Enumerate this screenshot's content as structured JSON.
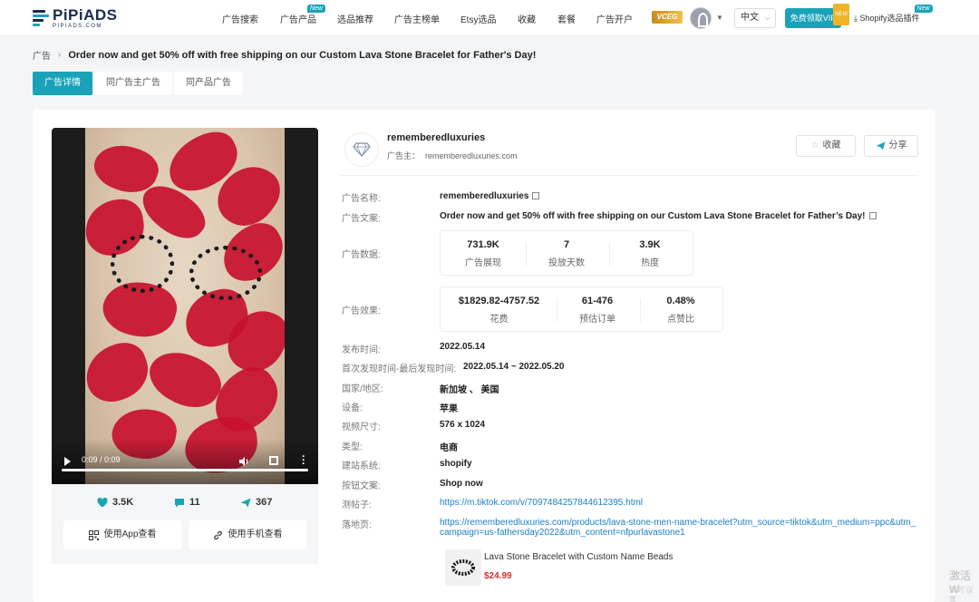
{
  "brand": {
    "name": "PiPiADS",
    "url": "PIPIADS.COM"
  },
  "nav": {
    "items": [
      {
        "label": "广告搜索",
        "badge": ""
      },
      {
        "label": "广告产品",
        "badge": "New"
      },
      {
        "label": "选品推荐",
        "badge": ""
      },
      {
        "label": "广告主榜单",
        "badge": ""
      },
      {
        "label": "Etsy选品",
        "badge": ""
      },
      {
        "label": "收藏",
        "badge": ""
      },
      {
        "label": "套餐",
        "badge": ""
      },
      {
        "label": "广告开户",
        "badge": ""
      }
    ],
    "vip_chip": "VCEG",
    "language": "中文",
    "vip_button": "免费领取VIP",
    "vip_tag": "NEW",
    "plugin": "Shopify选品插件",
    "plugin_badge": "New"
  },
  "breadcrumb": {
    "root": "广告",
    "title": "Order now and get 50% off with free shipping on our Custom Lava Stone Bracelet for Father's Day!"
  },
  "tabs": [
    "广告详情",
    "同广告主广告",
    "同产品广告"
  ],
  "video": {
    "time": "0:09 / 0:09",
    "stats": {
      "likes": "3.5K",
      "comments": "11",
      "shares": "367"
    },
    "app_button": "使用App查看",
    "phone_button": "使用手机查看"
  },
  "advertiser": {
    "name": "rememberedluxuries",
    "label": "广告主：",
    "domain": "rememberedluxuries.com",
    "collect": "收藏",
    "share": "分享"
  },
  "details": {
    "ad_name_label": "广告名称:",
    "ad_name": "rememberedluxuries",
    "ad_copy_label": "广告文案:",
    "ad_copy": "Order now and get 50% off with free shipping on our Custom Lava Stone Bracelet for Father’s Day!",
    "ad_data_label": "广告数据:",
    "ad_data": [
      {
        "value": "731.9K",
        "label": "广告展现"
      },
      {
        "value": "7",
        "label": "投放天数"
      },
      {
        "value": "3.9K",
        "label": "热度"
      }
    ],
    "ad_effect_label": "广告效果:",
    "ad_effect": [
      {
        "value": "$1829.82-4757.52",
        "label": "花费"
      },
      {
        "value": "61-476",
        "label": "预估订单"
      },
      {
        "value": "0.48%",
        "label": "点赞比"
      }
    ],
    "publish_label": "发布时间:",
    "publish": "2022.05.14",
    "first_last_label": "首次发现时间-最后发现时间:",
    "first_last": "2022.05.14 ~ 2022.05.20",
    "region_label": "国家/地区:",
    "region": "新加坡 、 美国",
    "device_label": "设备:",
    "device": "苹果",
    "size_label": "视频尺寸:",
    "size": "576 x 1024",
    "type_label": "类型:",
    "type": "电商",
    "site_label": "建站系统:",
    "site": "shopify",
    "button_label": "按钮文案:",
    "button": "Shop now",
    "testlink_label": "测帖子:",
    "testlink": "https://m.tiktok.com/v/7097484257844612395.html",
    "landing_label": "落地页:",
    "landing": "https://rememberedluxuries.com/products/lava-stone-men-name-bracelet?utm_source=tiktok&utm_medium=ppc&utm_campaign=us-fathersday2022&utm_content=nfpurlavastone1"
  },
  "product": {
    "name": "Lava Stone Bracelet with Custom Name Beads",
    "price": "$24.99"
  },
  "watermark": {
    "line1": "激活 W",
    "line2": "转到\"设置"
  },
  "colors": {
    "accent": "#1aa3b8",
    "price": "#d0312d",
    "link": "#1a7fc4"
  }
}
